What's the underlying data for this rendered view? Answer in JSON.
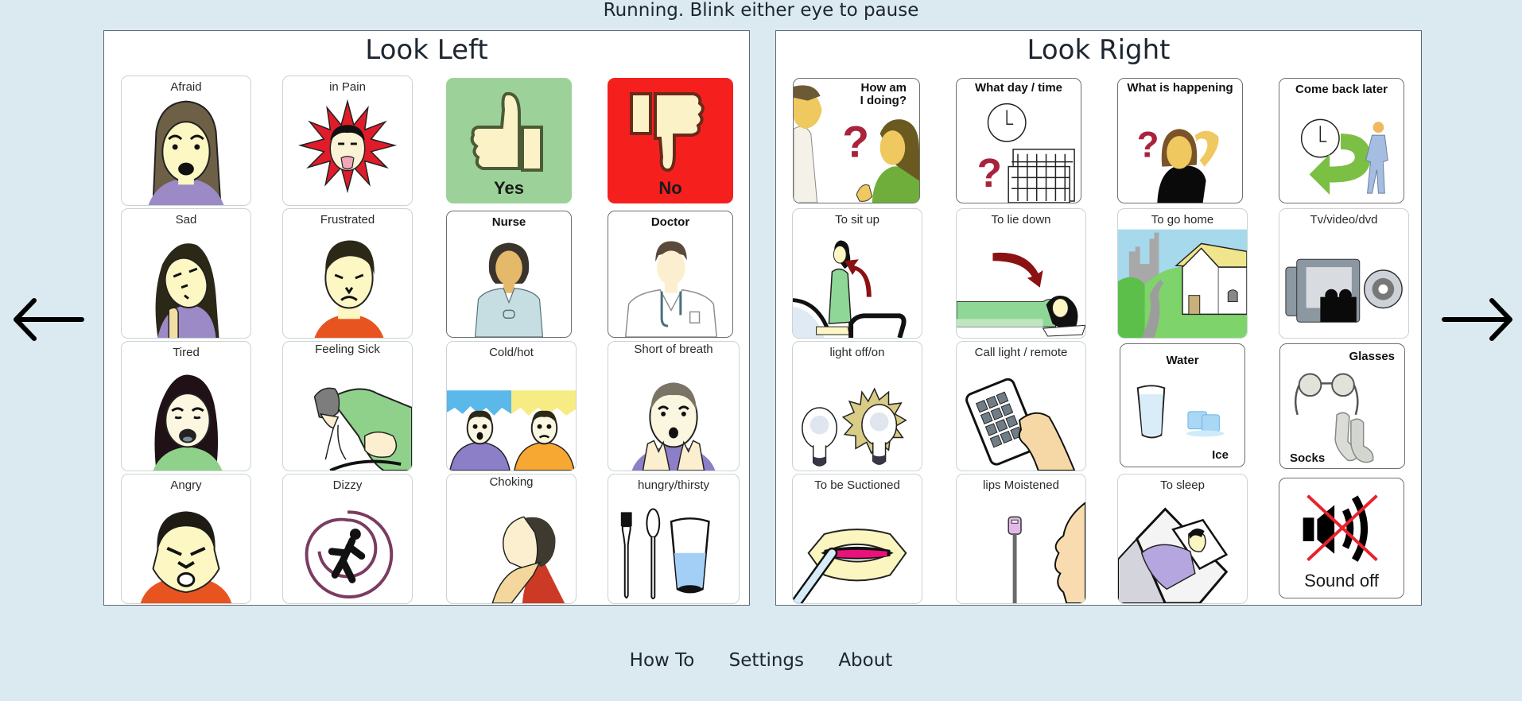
{
  "status_text": "Running. Blink either eye to pause",
  "nav": {
    "prev_icon": "arrow-left-icon",
    "next_icon": "arrow-right-icon"
  },
  "panels": [
    {
      "title": "Look Left",
      "cards": [
        {
          "label": "Afraid",
          "icon": "afraid-face"
        },
        {
          "label": "in Pain",
          "icon": "pain-burst-face"
        },
        {
          "label": "Yes",
          "icon": "thumbs-up"
        },
        {
          "label": "No",
          "icon": "thumbs-down"
        },
        {
          "label": "Sad",
          "icon": "sad-face"
        },
        {
          "label": "Frustrated",
          "icon": "frustrated-face"
        },
        {
          "label": "Nurse",
          "icon": "nurse"
        },
        {
          "label": "Doctor",
          "icon": "doctor"
        },
        {
          "label": "Tired",
          "icon": "tired-face"
        },
        {
          "label": "Feeling Sick",
          "icon": "vomiting-person"
        },
        {
          "label": "Cold/hot",
          "icon": "cold-hot-people"
        },
        {
          "label": "Short of breath",
          "icon": "breathless-face"
        },
        {
          "label": "Angry",
          "icon": "angry-face"
        },
        {
          "label": "Dizzy",
          "icon": "dizzy-spiral"
        },
        {
          "label": "Choking",
          "icon": "choking-person"
        },
        {
          "label": "hungry/thirsty",
          "icon": "fork-spoon-glass"
        }
      ]
    },
    {
      "title": "Look Right",
      "cards": [
        {
          "label": "How am I doing?",
          "icon": "doctor-patient-question"
        },
        {
          "label": "What day / time",
          "icon": "clock-calendar-question"
        },
        {
          "label": "What is happening",
          "icon": "confused-woman-question"
        },
        {
          "label": "Come back later",
          "icon": "clock-return-person"
        },
        {
          "label": "To sit up",
          "icon": "sit-up"
        },
        {
          "label": "To lie down",
          "icon": "lie-down"
        },
        {
          "label": "To go home",
          "icon": "house"
        },
        {
          "label": "Tv/video/dvd",
          "icon": "tv-video"
        },
        {
          "label": "light off/on",
          "icon": "light-bulbs"
        },
        {
          "label": "Call light / remote",
          "icon": "remote-hand"
        },
        {
          "label": "Water",
          "sublabel": "Ice",
          "icon": "water-ice"
        },
        {
          "label": "Glasses",
          "sublabel": "Socks",
          "icon": "glasses-socks"
        },
        {
          "label": "To be Suctioned",
          "icon": "mouth-suction"
        },
        {
          "label": "lips Moistened",
          "icon": "lip-swab"
        },
        {
          "label": "To sleep",
          "icon": "sleeping-person"
        },
        {
          "label": "Sound off",
          "icon": "speaker-muted"
        }
      ]
    }
  ],
  "footer": {
    "links": [
      "How To",
      "Settings",
      "About"
    ]
  },
  "colors": {
    "background": "#dbe9f1",
    "yes_green": "#9dd19a",
    "no_red": "#f5201e"
  }
}
